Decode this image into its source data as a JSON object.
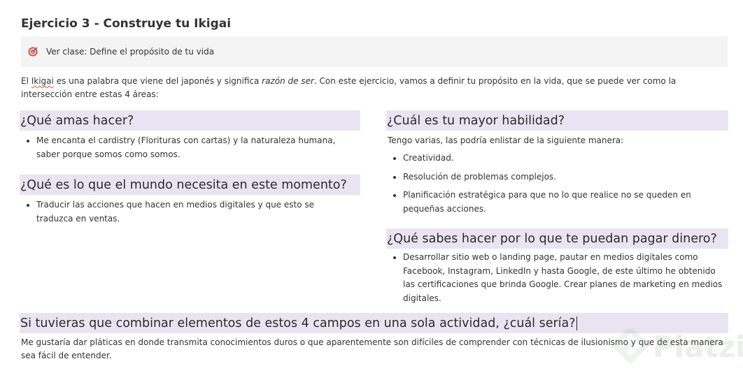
{
  "page_title": "Ejercicio 3 - Construye tu Ikigai",
  "callout": {
    "icon": "target-icon",
    "text": "Ver clase: Define el propósito de tu vida"
  },
  "intro": {
    "p1": "El ",
    "ikigai": "Ikigai",
    "p2": " es una palabra que viene del japonés y significa ",
    "em": "razón de ser",
    "p3": ". Con este ejercicio, vamos a definir tu propósito en la vida, que se puede ver como la intersección entre estas 4 áreas:"
  },
  "love": {
    "heading": "¿Qué amas hacer?",
    "items": [
      "Me encanta el cardistry (Florituras con cartas) y  la naturaleza humana, saber porque somos como somos."
    ]
  },
  "world": {
    "heading": "¿Qué es lo que el mundo necesita en este momento?",
    "items": [
      "Traducir las acciones que hacen en medios digitales y que esto se traduzca en ventas."
    ]
  },
  "skill": {
    "heading": "¿Cuál es tu mayor habilidad?",
    "intro": "Tengo varias, las podría enlistar de la siguiente manera:",
    "items": [
      "Creatividad.",
      "Resolución de problemas complejos.",
      "Planificación estratégica para que no lo que realice no se queden en pequeñas acciones."
    ]
  },
  "paid": {
    "heading": "¿Qué sabes hacer por lo que te puedan pagar dinero?",
    "items": [
      "Desarrollar sitio web o landing page, pautar en medios digitales como Facebook, Instagram, LinkedIn y hasta Google, de este último he obtenido las certificaciones que brinda Google. Crear planes de marketing en medios digitales."
    ]
  },
  "combine": {
    "heading": "Si tuvieras que combinar elementos de estos 4 campos en una sola actividad, ¿cuál sería?",
    "answer": "Me gustaría dar pláticas en donde transmita conocimientos duros o que aparentemente son difíciles de comprender con técnicas de ilusionismo y que de esta manera sea fácil de entender."
  },
  "watermark": {
    "text": "Platzi",
    "icon": "platzi-logo-icon"
  },
  "colors": {
    "heading_bg": "#eae4f2",
    "callout_bg": "#f4f4f4",
    "target_red": "#e0413a"
  }
}
